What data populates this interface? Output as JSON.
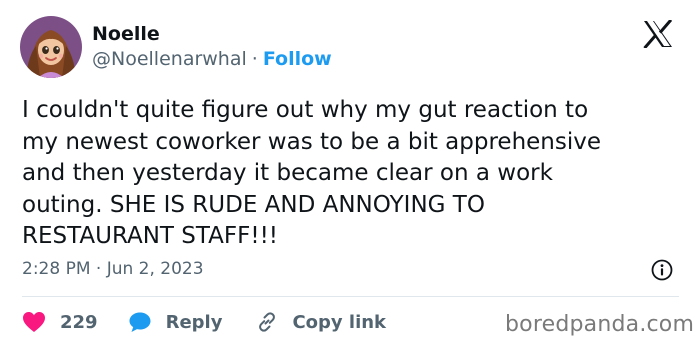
{
  "author": {
    "name": "Noelle",
    "handle": "@Noellenarwhal",
    "separator": "·",
    "follow_label": "Follow"
  },
  "tweet": {
    "text": "I couldn't quite figure out why my gut reaction to\nmy newest coworker was to be a bit apprehensive\nand then yesterday it became clear on a work\nouting. SHE IS RUDE AND ANNOYING TO\nRESTAURANT STAFF!!!",
    "timestamp": "2:28 PM · Jun 2, 2023"
  },
  "actions": {
    "like_count": "229",
    "reply_label": "Reply",
    "copy_label": "Copy link"
  },
  "watermark": "boredpanda.com",
  "colors": {
    "accent": "#1d9bf0",
    "like": "#f91880",
    "text": "#0f1419",
    "secondary": "#536471"
  },
  "icons": {
    "logo": "x-logo-icon",
    "info": "info-icon",
    "like": "heart-icon",
    "reply": "speech-bubble-icon",
    "copy": "link-icon"
  }
}
